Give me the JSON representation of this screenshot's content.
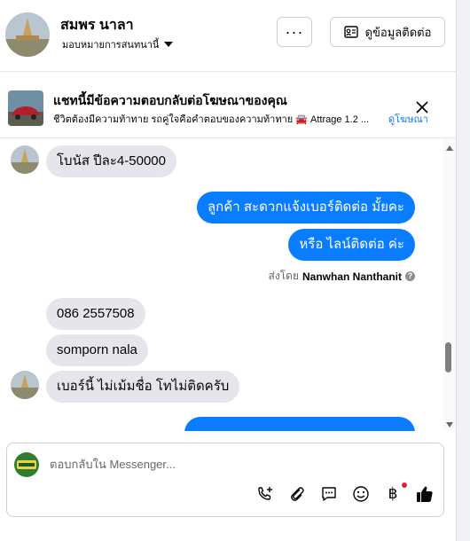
{
  "header": {
    "name": "สมพร นาลา",
    "role": "มอบหมายการสนทนานี้",
    "more_label": "···",
    "contact_label": "ดูข้อมูลติดต่อ"
  },
  "ad_banner": {
    "title": "แชทนี้มีข้อความตอบกลับต่อโฆษณาของคุณ",
    "subtitle": "ชีวิตต้องมีความท้าทาย รถคู่ใจคือคำตอบของความท้าทาย 🚘 Attrage 1.2 ...",
    "link_label": "ดูโฆษณา"
  },
  "messages": [
    {
      "side": "in",
      "text": "โบนัส ปีละ4-50000"
    },
    {
      "side": "out",
      "text": "ลูกค้า สะดวกแจ้งเบอร์ติดต่อ มั้ยคะ"
    },
    {
      "side": "out",
      "text": "หรือ ไลน์ติดต่อ ค่ะ"
    },
    {
      "side": "in",
      "text": "086 2557508"
    },
    {
      "side": "in",
      "text": "somporn nala"
    },
    {
      "side": "in",
      "text": "เบอร์นี้ ไม่เม้มชื่อ โทไม่ติดครับ"
    }
  ],
  "sent_by": {
    "prefix": "ส่งโดย",
    "agent": "Nanwhan Nanthanit"
  },
  "composer": {
    "placeholder": "ตอบกลับใน Messenger...",
    "baht_symbol": "฿"
  },
  "colors": {
    "outgoing_bubble": "#0a7cff",
    "incoming_bubble": "#e4e6eb",
    "link": "#1877f2",
    "thumbs_up": "#050505"
  },
  "icons": [
    "more-icon",
    "contact-card-icon",
    "close-icon",
    "help-icon",
    "call-add-icon",
    "attach-icon",
    "saved-reply-icon",
    "emoji-icon",
    "baht-icon",
    "like-icon"
  ]
}
